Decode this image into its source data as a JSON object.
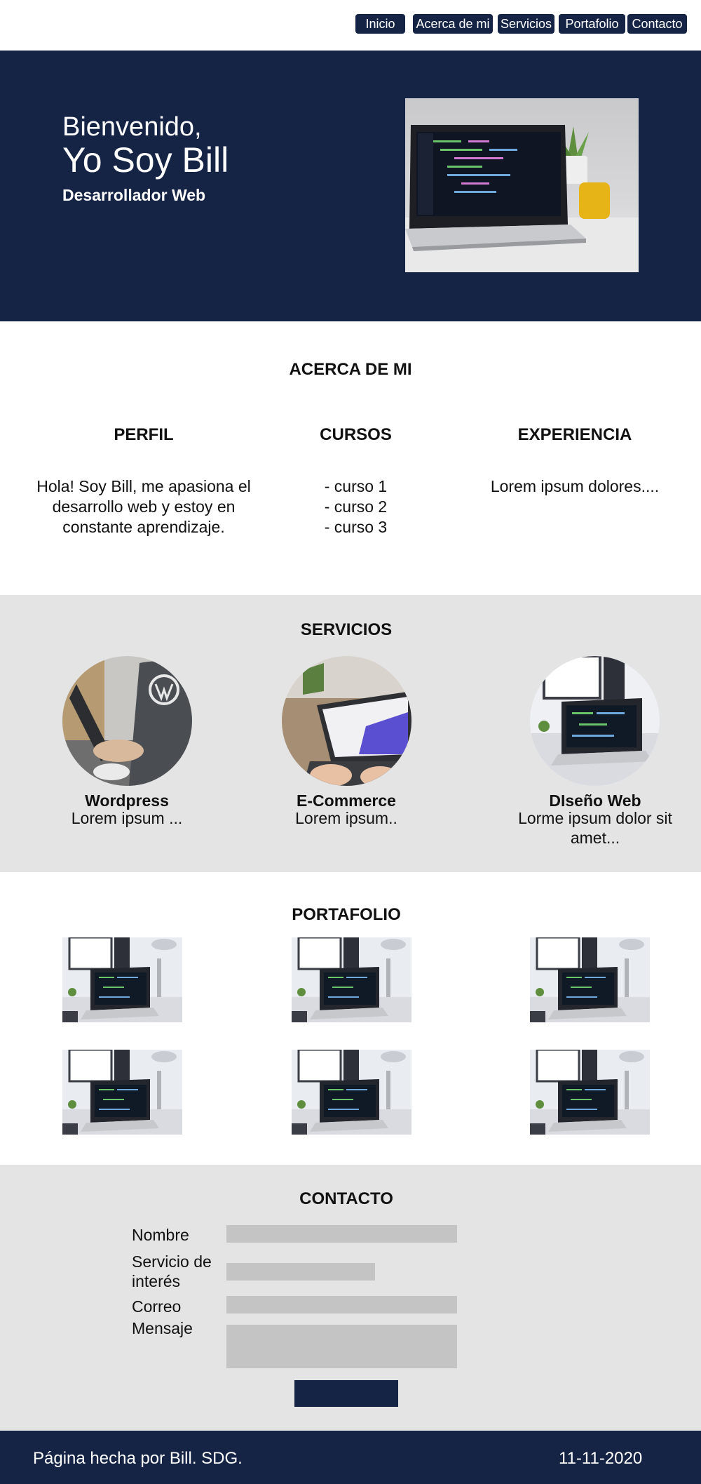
{
  "nav": {
    "items": [
      "Inicio",
      "Acerca de mi",
      "Servicios",
      "Portafolio",
      "Contacto"
    ]
  },
  "hero": {
    "greeting": "Bienvenido,",
    "name": "Yo Soy Bill",
    "role": "Desarrollador Web"
  },
  "about": {
    "title": "ACERCA DE MI",
    "columns": [
      {
        "title": "PERFIL",
        "text": "Hola! Soy Bill, me apasiona el desarrollo web y estoy en constante aprendizaje."
      },
      {
        "title": "CURSOS",
        "lines": [
          "- curso 1",
          "- curso 2",
          "- curso 3"
        ]
      },
      {
        "title": "EXPERIENCIA",
        "text": "Lorem ipsum dolores...."
      }
    ]
  },
  "services": {
    "title": "SERVICIOS",
    "items": [
      {
        "name": "Wordpress",
        "desc": "Lorem ipsum ..."
      },
      {
        "name": "E-Commerce",
        "desc": "Lorem ipsum.."
      },
      {
        "name": "DIseño Web",
        "desc": "Lorme ipsum dolor sit amet..."
      }
    ]
  },
  "portfolio": {
    "title": "PORTAFOLIO"
  },
  "contact": {
    "title": "CONTACTO",
    "labels": {
      "name": "Nombre",
      "service": "Servicio de interés",
      "email": "Correo",
      "message": "Mensaje"
    }
  },
  "footer": {
    "credit": "Página hecha por Bill. SDG.",
    "date": "11-11-2020"
  },
  "colors": {
    "navy": "#152344",
    "section_gray": "#e4e4e5",
    "field_gray": "#c4c4c4"
  }
}
